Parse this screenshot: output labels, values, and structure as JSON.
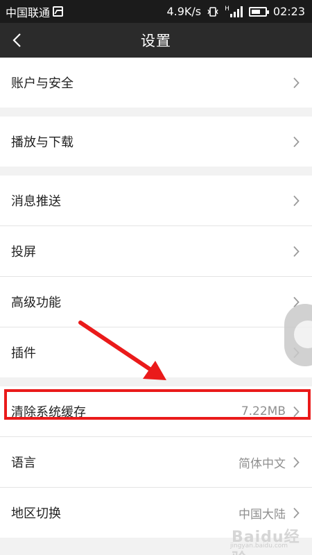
{
  "status_bar": {
    "carrier": "中国联通",
    "speed": "4.9K/s",
    "signal_label": "H",
    "time": "02:23"
  },
  "header": {
    "title": "设置"
  },
  "settings": {
    "account": {
      "label": "账户与安全"
    },
    "playback": {
      "label": "播放与下载"
    },
    "push": {
      "label": "消息推送"
    },
    "cast": {
      "label": "投屏"
    },
    "advanced": {
      "label": "高级功能"
    },
    "plugins": {
      "label": "插件"
    },
    "cache": {
      "label": "清除系统缓存",
      "value": "7.22MB"
    },
    "language": {
      "label": "语言",
      "value": "简体中文"
    },
    "region": {
      "label": "地区切换",
      "value": "中国大陆"
    }
  },
  "watermark": {
    "text": "Baidu经验",
    "url": "jingyan.baidu.com"
  },
  "colors": {
    "status_bg": "#1b1b1b",
    "title_bg": "#2b2b2b",
    "annotation": "#ea1a1a",
    "page_bg": "#f2f2f2"
  }
}
